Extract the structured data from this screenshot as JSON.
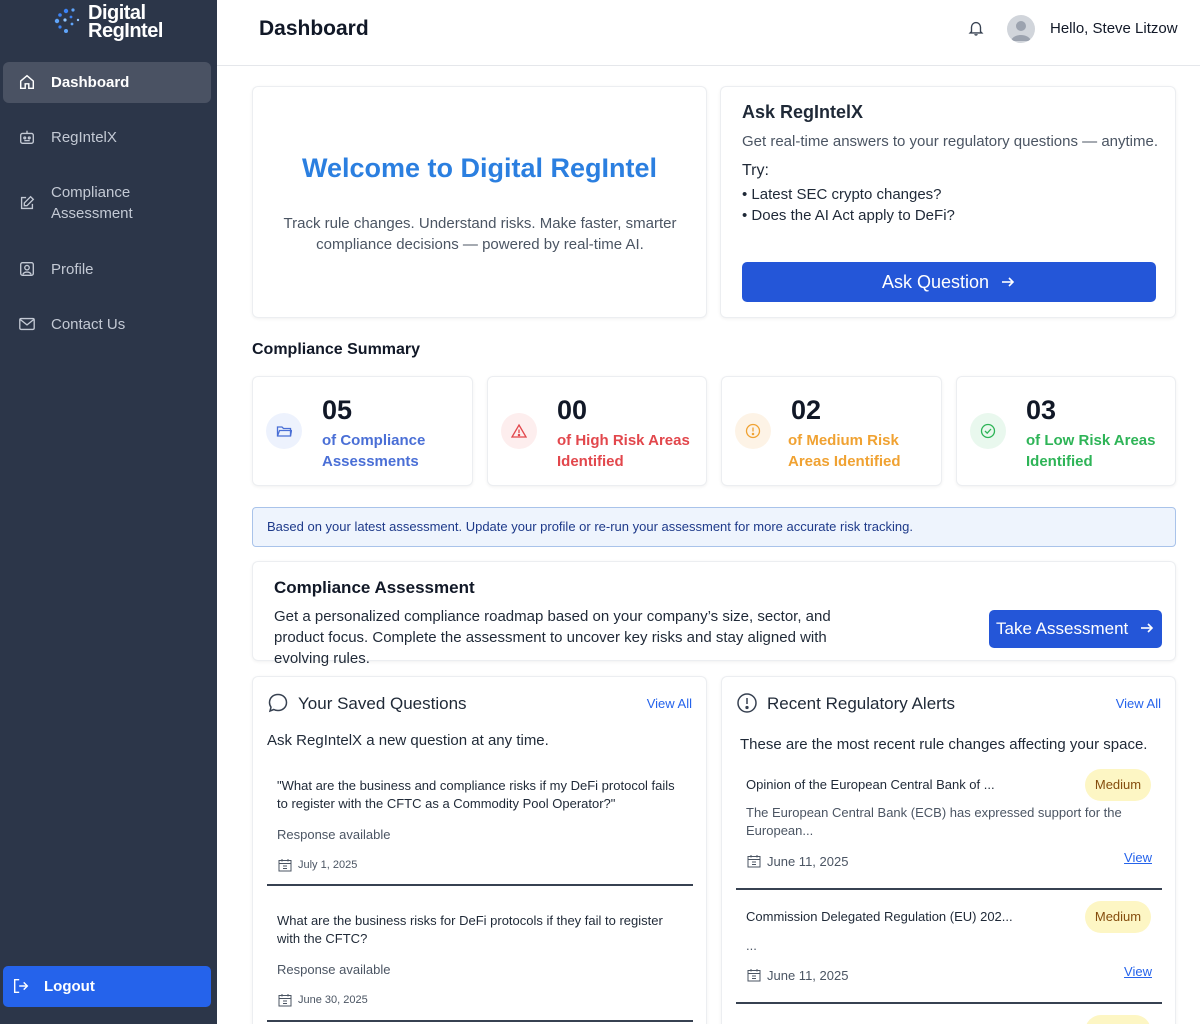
{
  "brand": {
    "line1": "Digital",
    "line2": "RegIntel"
  },
  "sidebar": {
    "items": [
      {
        "label": "Dashboard",
        "icon": "home-icon"
      },
      {
        "label": "RegIntelX",
        "icon": "robot-icon"
      },
      {
        "label": "Compliance\nAssessment",
        "icon": "edit-icon"
      },
      {
        "label": "Profile",
        "icon": "profile-icon"
      },
      {
        "label": "Contact Us",
        "icon": "mail-icon"
      }
    ],
    "logout": "Logout"
  },
  "header": {
    "title": "Dashboard",
    "greeting": "Hello, Steve Litzow"
  },
  "welcome": {
    "title": "Welcome to Digital RegIntel",
    "subtitle": "Track rule changes. Understand risks. Make faster, smarter compliance decisions — powered by real-time AI."
  },
  "ask": {
    "title": "Ask RegIntelX",
    "subtitle": "Get real-time answers to your regulatory questions — anytime.",
    "try_label": "Try:",
    "examples": [
      "• Latest SEC crypto changes?",
      "• Does the AI Act apply to DeFi?"
    ],
    "button": "Ask Question"
  },
  "summary": {
    "title": "Compliance Summary",
    "stats": [
      {
        "value": "05",
        "label": "of Compliance Assessments",
        "color": "#4a6fd6"
      },
      {
        "value": "00",
        "label": "of High Risk Areas Identified",
        "color": "#e2474c"
      },
      {
        "value": "02",
        "label": "of Medium Risk Areas Identified",
        "color": "#f0a232"
      },
      {
        "value": "03",
        "label": "of Low Risk Areas Identified",
        "color": "#2eb457"
      }
    ],
    "info": "Based on your latest assessment. Update your profile or re-run your assessment for more accurate risk tracking."
  },
  "assessment": {
    "title": "Compliance Assessment",
    "description": "Get a personalized compliance roadmap based on your company’s size, sector, and product focus. Complete the assessment to uncover key risks and stay aligned with evolving rules.",
    "button": "Take Assessment"
  },
  "saved_questions": {
    "title": "Your Saved Questions",
    "view_all": "View All",
    "intro": "Ask RegIntelX a new question at any time.",
    "items": [
      {
        "text": "\"What are the business and compliance risks if my DeFi protocol fails to register with the CFTC as a Commodity Pool Operator?\"",
        "status": "Response available",
        "date": "July 1, 2025"
      },
      {
        "text": "What are the business risks for DeFi protocols if they fail to register with the CFTC?",
        "status": "Response available",
        "date": "June 30, 2025"
      }
    ]
  },
  "alerts": {
    "title": "Recent Regulatory Alerts",
    "view_all": "View All",
    "intro": "These are the most recent rule changes affecting your space.",
    "items": [
      {
        "title": "Opinion of the European Central Bank of ...",
        "badge": "Medium",
        "description": "The European Central Bank (ECB) has expressed support for the European...",
        "date": "June 11, 2025",
        "view": "View"
      },
      {
        "title": "Commission Delegated Regulation (EU) 202...",
        "badge": "Medium",
        "description": "...",
        "date": "June 11, 2025",
        "view": "View"
      }
    ]
  }
}
